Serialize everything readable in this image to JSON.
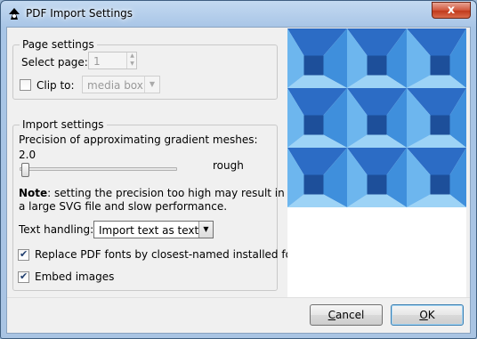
{
  "window": {
    "title": "PDF Import Settings",
    "close_label": "x"
  },
  "page_settings": {
    "group_title": "Page settings",
    "select_page_label": "Select page:",
    "select_page_value": "1",
    "clip_label": "Clip to:",
    "clip_checked": false,
    "clip_value": "media box"
  },
  "import_settings": {
    "group_title": "Import settings",
    "precision_label": "Precision of approximating gradient meshes:",
    "precision_value": "2.0",
    "precision_slider_fraction": 0.0,
    "rough_label": "rough",
    "note_bold": "Note",
    "note_line1": ": setting the precision too high may result in",
    "note_line2": "a large SVG file and slow performance.",
    "text_handling_label": "Text handling:",
    "text_handling_value": "Import text as text",
    "replace_fonts_label": "Replace PDF fonts by closest-named installed fonts",
    "replace_fonts_checked": true,
    "embed_images_label": "Embed images",
    "embed_images_checked": true
  },
  "buttons": {
    "cancel_mnemonic": "C",
    "cancel_rest": "ancel",
    "ok_mnemonic": "O",
    "ok_rest": "K"
  },
  "colors": {
    "preview_dark": "#1d4f9a",
    "preview_mid": "#2c6cc5",
    "preview_blue": "#3f8fdc",
    "preview_light": "#6db6ee",
    "preview_pale": "#9dd3f6"
  }
}
